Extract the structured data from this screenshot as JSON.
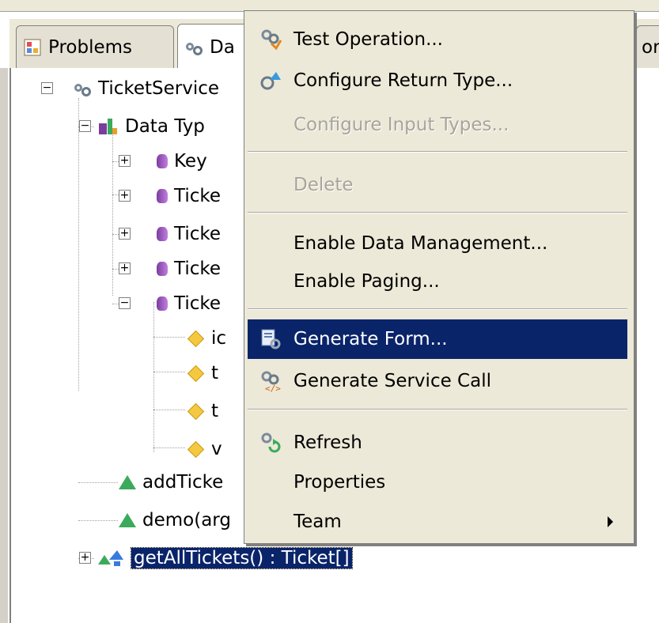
{
  "tabs": [
    {
      "label": "Problems",
      "icon": "problems-icon"
    },
    {
      "label": "Da",
      "icon": "data-services-icon"
    },
    {
      "label": "or",
      "icon": ""
    }
  ],
  "tree": {
    "root": "TicketService",
    "data_types": "Data Typ",
    "types": [
      "Key",
      "Ticke",
      "Ticke",
      "Ticke",
      "Ticke"
    ],
    "fields": [
      "ic",
      "t",
      "t",
      "v"
    ],
    "operations": [
      "addTicke",
      "demo(arg"
    ],
    "selected_operation": "getAllTickets() : Ticket[]"
  },
  "context_menu": {
    "items": [
      {
        "label": "Test Operation...",
        "icon": "test-operation-icon",
        "enabled": true
      },
      {
        "label": "Configure Return Type...",
        "icon": "configure-return-type-icon",
        "enabled": true
      },
      {
        "label": "Configure Input Types...",
        "icon": "",
        "enabled": false
      },
      {
        "label": "Delete",
        "icon": "",
        "enabled": false
      },
      {
        "label": "Enable Data Management...",
        "icon": "",
        "enabled": true
      },
      {
        "label": "Enable Paging...",
        "icon": "",
        "enabled": true
      },
      {
        "label": "Generate Form...",
        "icon": "generate-form-icon",
        "enabled": true,
        "highlighted": true
      },
      {
        "label": "Generate Service Call",
        "icon": "generate-service-call-icon",
        "enabled": true
      },
      {
        "label": "Refresh",
        "icon": "refresh-icon",
        "enabled": true
      },
      {
        "label": "Properties",
        "icon": "",
        "enabled": true
      },
      {
        "label": "Team",
        "icon": "",
        "enabled": true,
        "submenu": true
      }
    ]
  },
  "colors": {
    "highlight": "#0a246a",
    "menu_bg": "#ece9d8",
    "disabled_text": "#a8a49a"
  }
}
